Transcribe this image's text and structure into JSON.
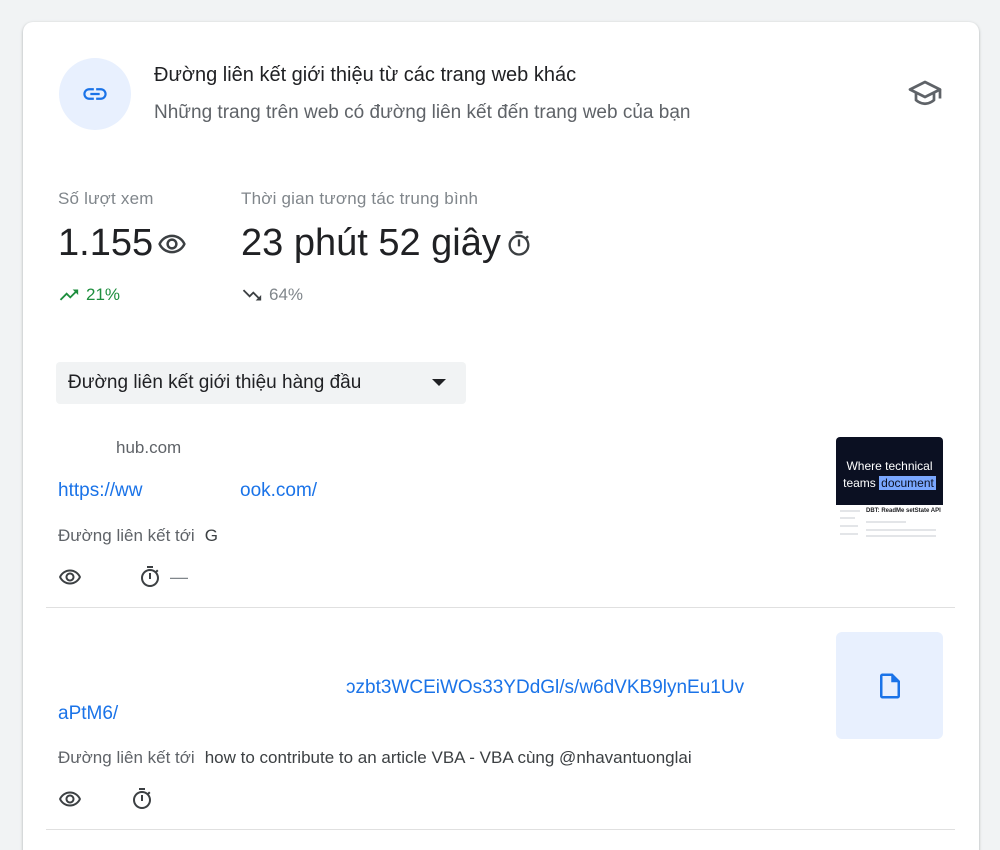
{
  "header": {
    "title": "Đường liên kết giới thiệu từ các trang web khác",
    "subtitle": "Những trang trên web có đường liên kết đến trang web của bạn",
    "icon": "link-icon",
    "help_icon": "graduation-cap-icon"
  },
  "metrics": {
    "views": {
      "label": "Số lượt xem",
      "value": "1.155",
      "trend": "21%",
      "trend_direction": "up",
      "trend_color": "#1e8e3e"
    },
    "engagement": {
      "label": "Thời gian tương tác trung bình",
      "value": "23 phút 52 giây",
      "trend": "64%",
      "trend_direction": "down",
      "trend_color": "#80868b"
    }
  },
  "dropdown": {
    "label": "Đường liên kết giới thiệu hàng đầu"
  },
  "rows": [
    {
      "domain": "hub.com",
      "url_part1": "https://ww",
      "url_part2": "ook.com/",
      "target_label": "Đường liên kết tới",
      "target_page": "G",
      "time_value": "—",
      "thumbnail_line1": "Where technical",
      "thumbnail_line2a": "teams",
      "thumbnail_line2b": "document",
      "thumbnail_sub": "DBT: ReadMe setState API"
    },
    {
      "url_line1": "ɔzbt3WCEiWOs33YDdGl/s/w6dVKB9lynEu1Uv",
      "url_line2": "aPtM6/",
      "target_label": "Đường liên kết tới",
      "target_page": "how to contribute to an article VBA - VBA cùng @nhavantuonglai",
      "thumbnail_icon": "document-icon"
    }
  ],
  "colors": {
    "accent": "#1a73e8",
    "icon_bg": "#e8f0fe",
    "muted": "#5f6368"
  }
}
